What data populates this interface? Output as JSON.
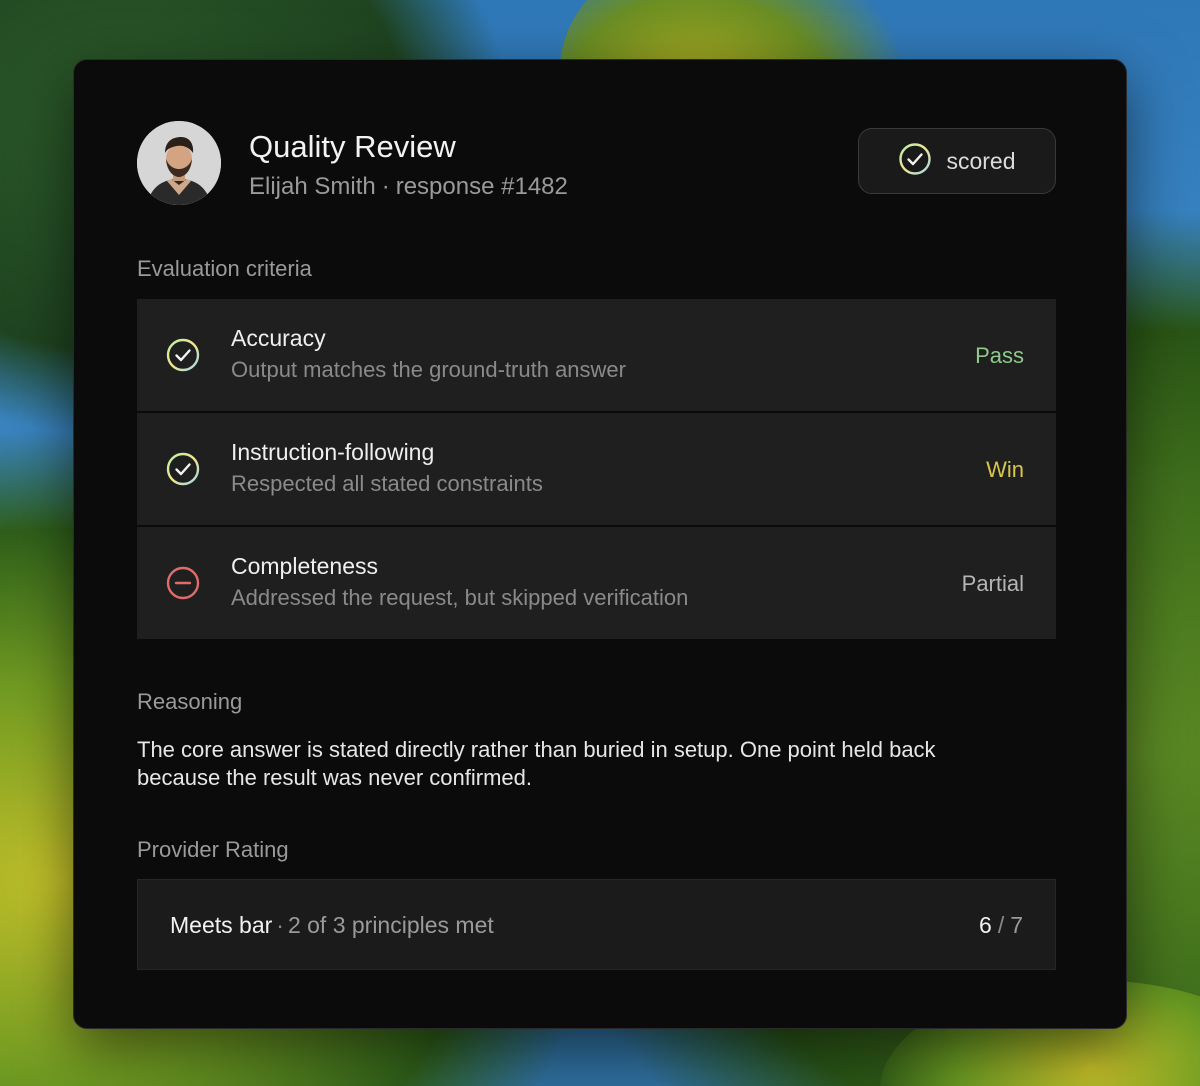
{
  "header": {
    "title": "Quality Review",
    "author": "Elijah Smith",
    "separator": "·",
    "response": "response #1482",
    "status": "scored"
  },
  "criteria_section": {
    "label": "Evaluation criteria",
    "items": [
      {
        "name": "Accuracy",
        "description": "Output matches the ground-truth answer",
        "result": "Pass",
        "icon": "check-circle-icon",
        "result_color": "#8fc98b"
      },
      {
        "name": "Instruction-following",
        "description": "Respected all stated constraints",
        "result": "Win",
        "icon": "check-circle-icon",
        "result_color": "#d8c64a"
      },
      {
        "name": "Completeness",
        "description": "Addressed the request, but skipped verification",
        "result": "Partial",
        "icon": "minus-circle-icon",
        "result_color": "#b5b5b5"
      }
    ]
  },
  "reasoning": {
    "label": "Reasoning",
    "text": "The core answer is stated directly rather than buried in setup. One point held back because the result was never confirmed."
  },
  "rating": {
    "section_label": "Provider Rating",
    "label": "Meets bar",
    "separator": "·",
    "detail": "2 of 3 principles met",
    "score": "6",
    "score_separator": "/",
    "score_max": "7"
  },
  "colors": {
    "card_bg": "#0b0b0b",
    "row_bg": "#1f1f1f",
    "check_gradient": [
      "#b9f0a8",
      "#f0e68c",
      "#9ed8f0"
    ],
    "minus_color": "#e06b6b"
  }
}
